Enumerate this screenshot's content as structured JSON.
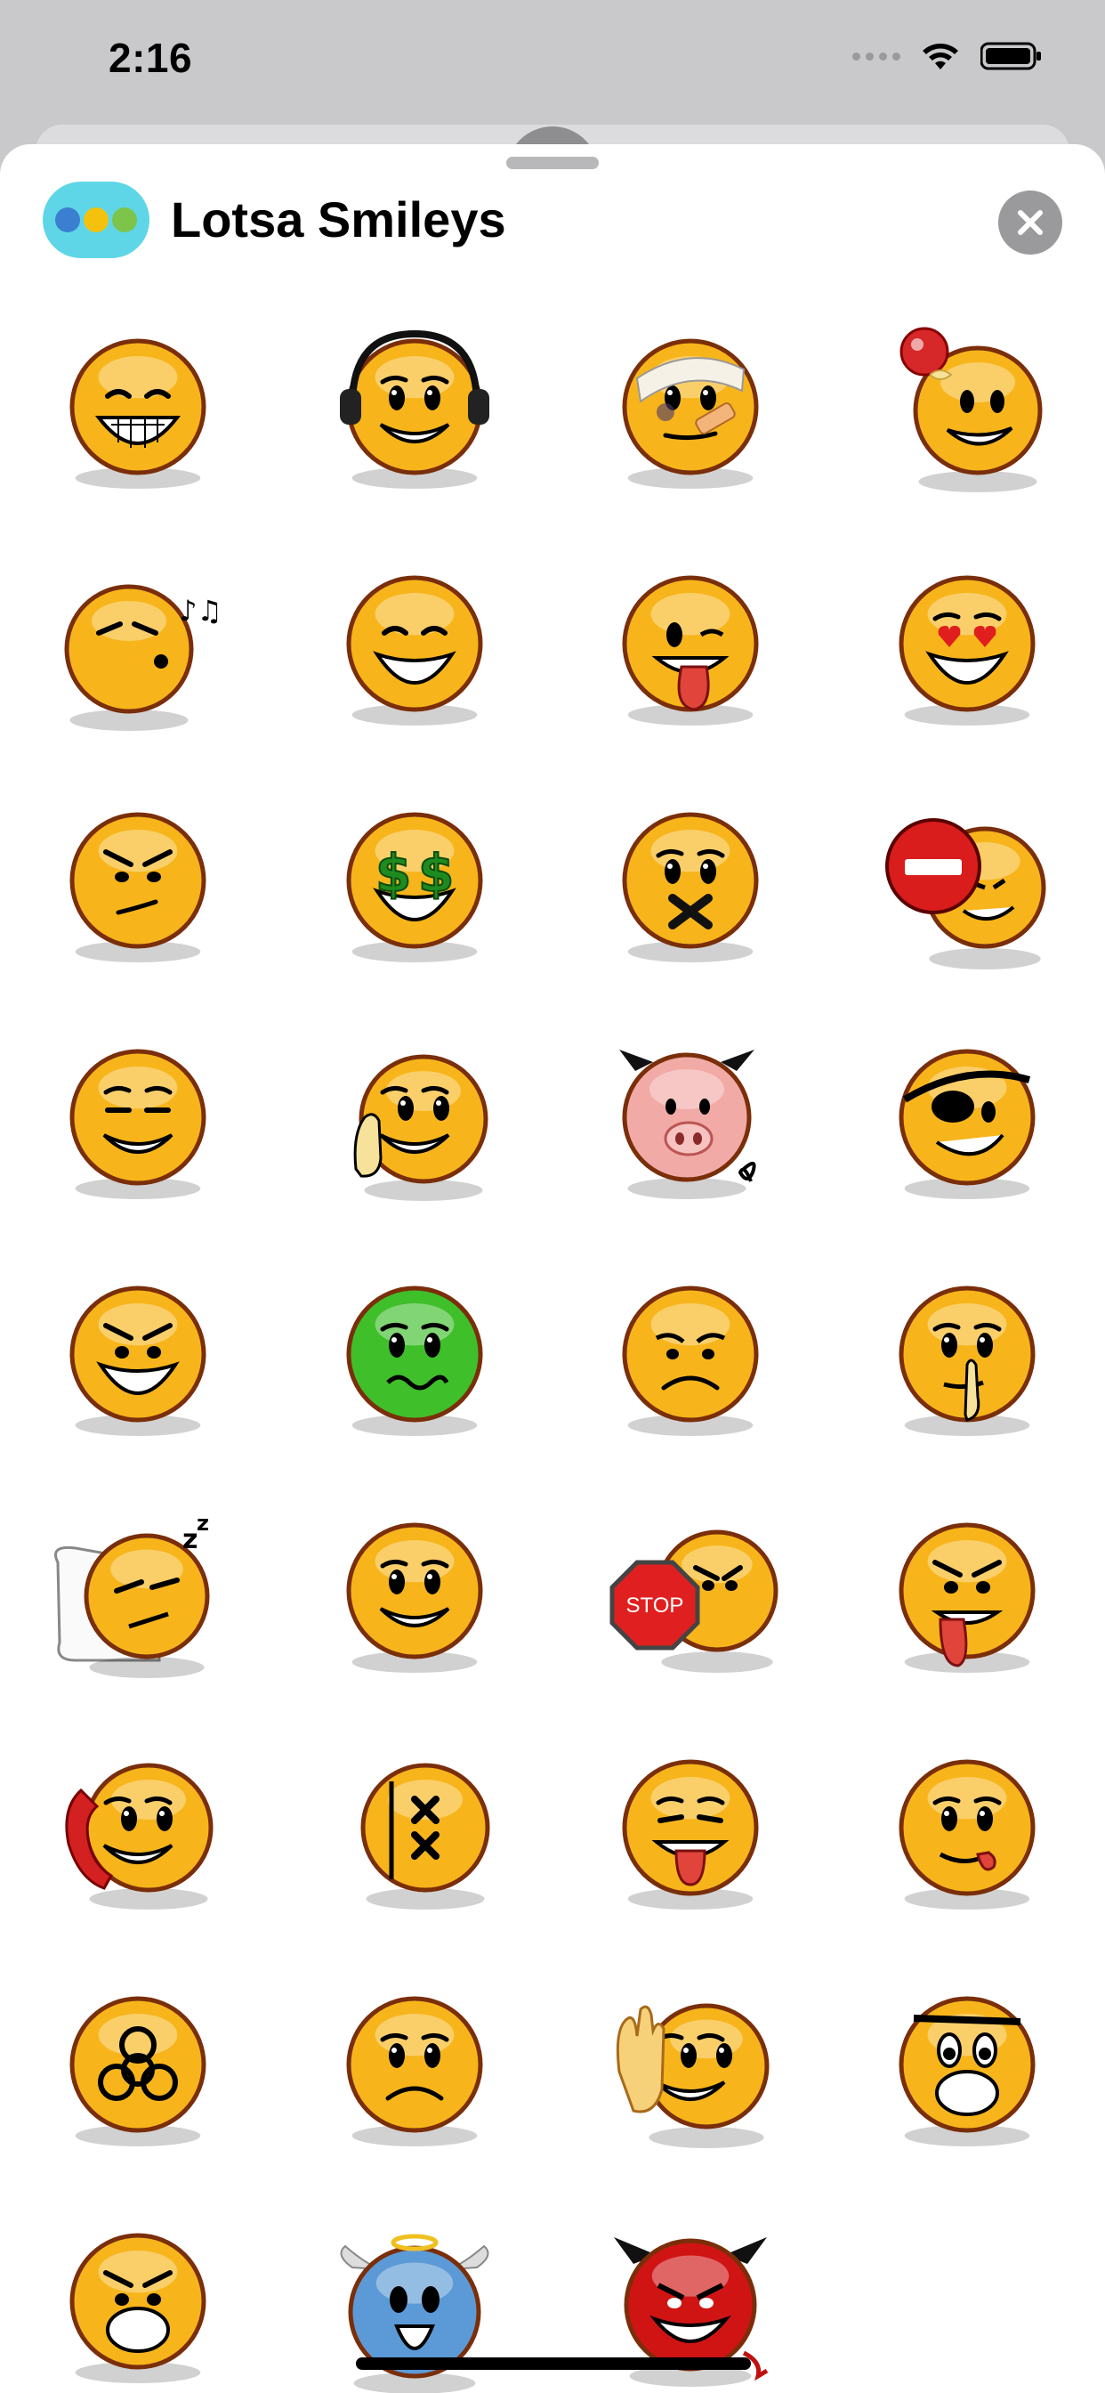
{
  "status_bar": {
    "time": "2:16"
  },
  "sheet": {
    "title": "Lotsa Smileys",
    "close_icon": "close-icon",
    "app_icon": "lotsa-smileys-app-icon"
  },
  "colors": {
    "sheet_bg": "#ffffff",
    "status_bg": "#c9c9cb",
    "smiley_yellow": "#f7b51b",
    "smiley_outline": "#7a2e0a",
    "green_face": "#3fbf2a",
    "pig_pink": "#f2aaa6",
    "angel_blue": "#5b9ad6",
    "devil_red": "#d01414"
  },
  "stickers": [
    "big-grin-sticker",
    "headphones-sticker",
    "bandaged-injured-sticker",
    "bump-on-head-sticker",
    "whistling-sticker",
    "grin-sticker",
    "tongue-out-sticker",
    "heart-eyes-sticker",
    "annoyed-sticker",
    "dollar-eyes-sticker",
    "mouth-taped-sticker",
    "no-entry-sticker",
    "content-smile-sticker",
    "thinking-hand-sticker",
    "pig-sticker",
    "pirate-eyepatch-sticker",
    "smirk-sticker",
    "sick-green-sticker",
    "sad-sticker",
    "shush-sticker",
    "sleeping-pillow-sticker",
    "smile-sticker",
    "stop-sign-sticker",
    "drooling-sticker",
    "phone-call-sticker",
    "crossed-out-eyes-sticker",
    "tongue-sticker",
    "lip-lick-sticker",
    "biohazard-sticker",
    "frown-sticker",
    "waving-hand-sticker",
    "shocked-sticker",
    "angry-gasp-sticker",
    "angel-sticker",
    "devil-sticker"
  ],
  "stop_label": "STOP"
}
